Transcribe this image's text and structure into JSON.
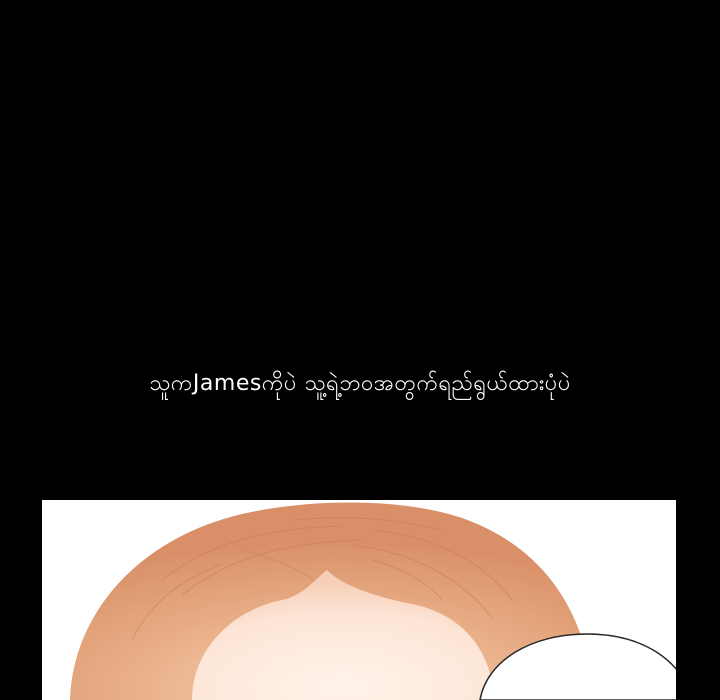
{
  "caption": {
    "text": "သူကJamesကိုပဲ သူ့ရဲ့ဘ၀အတွက်ရည်ရွယ်ထားပုံပဲ"
  },
  "panel": {
    "background_color": "#ffffff",
    "hair_color": "#e2a47e",
    "skin_color": "#fde9dc",
    "outline_color": "#2a2a2a"
  },
  "page": {
    "background_color": "#000000"
  }
}
